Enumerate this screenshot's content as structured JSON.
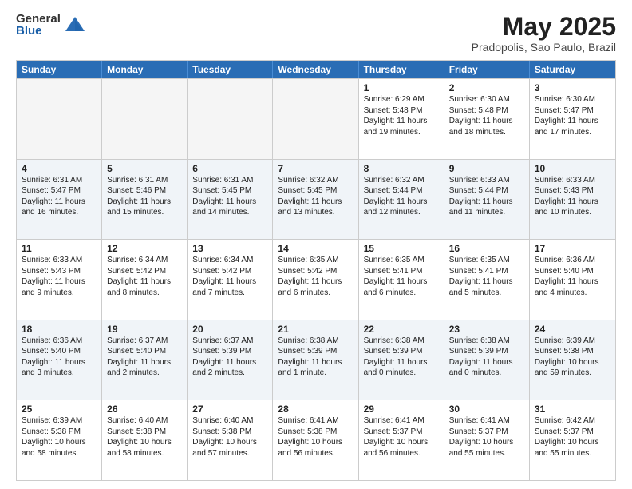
{
  "logo": {
    "general": "General",
    "blue": "Blue"
  },
  "title": "May 2025",
  "subtitle": "Pradopolis, Sao Paulo, Brazil",
  "header_days": [
    "Sunday",
    "Monday",
    "Tuesday",
    "Wednesday",
    "Thursday",
    "Friday",
    "Saturday"
  ],
  "rows": [
    [
      {
        "day": "",
        "text": "",
        "empty": true
      },
      {
        "day": "",
        "text": "",
        "empty": true
      },
      {
        "day": "",
        "text": "",
        "empty": true
      },
      {
        "day": "",
        "text": "",
        "empty": true
      },
      {
        "day": "1",
        "text": "Sunrise: 6:29 AM\nSunset: 5:48 PM\nDaylight: 11 hours\nand 19 minutes."
      },
      {
        "day": "2",
        "text": "Sunrise: 6:30 AM\nSunset: 5:48 PM\nDaylight: 11 hours\nand 18 minutes."
      },
      {
        "day": "3",
        "text": "Sunrise: 6:30 AM\nSunset: 5:47 PM\nDaylight: 11 hours\nand 17 minutes."
      }
    ],
    [
      {
        "day": "4",
        "text": "Sunrise: 6:31 AM\nSunset: 5:47 PM\nDaylight: 11 hours\nand 16 minutes."
      },
      {
        "day": "5",
        "text": "Sunrise: 6:31 AM\nSunset: 5:46 PM\nDaylight: 11 hours\nand 15 minutes."
      },
      {
        "day": "6",
        "text": "Sunrise: 6:31 AM\nSunset: 5:45 PM\nDaylight: 11 hours\nand 14 minutes."
      },
      {
        "day": "7",
        "text": "Sunrise: 6:32 AM\nSunset: 5:45 PM\nDaylight: 11 hours\nand 13 minutes."
      },
      {
        "day": "8",
        "text": "Sunrise: 6:32 AM\nSunset: 5:44 PM\nDaylight: 11 hours\nand 12 minutes."
      },
      {
        "day": "9",
        "text": "Sunrise: 6:33 AM\nSunset: 5:44 PM\nDaylight: 11 hours\nand 11 minutes."
      },
      {
        "day": "10",
        "text": "Sunrise: 6:33 AM\nSunset: 5:43 PM\nDaylight: 11 hours\nand 10 minutes."
      }
    ],
    [
      {
        "day": "11",
        "text": "Sunrise: 6:33 AM\nSunset: 5:43 PM\nDaylight: 11 hours\nand 9 minutes."
      },
      {
        "day": "12",
        "text": "Sunrise: 6:34 AM\nSunset: 5:42 PM\nDaylight: 11 hours\nand 8 minutes."
      },
      {
        "day": "13",
        "text": "Sunrise: 6:34 AM\nSunset: 5:42 PM\nDaylight: 11 hours\nand 7 minutes."
      },
      {
        "day": "14",
        "text": "Sunrise: 6:35 AM\nSunset: 5:42 PM\nDaylight: 11 hours\nand 6 minutes."
      },
      {
        "day": "15",
        "text": "Sunrise: 6:35 AM\nSunset: 5:41 PM\nDaylight: 11 hours\nand 6 minutes."
      },
      {
        "day": "16",
        "text": "Sunrise: 6:35 AM\nSunset: 5:41 PM\nDaylight: 11 hours\nand 5 minutes."
      },
      {
        "day": "17",
        "text": "Sunrise: 6:36 AM\nSunset: 5:40 PM\nDaylight: 11 hours\nand 4 minutes."
      }
    ],
    [
      {
        "day": "18",
        "text": "Sunrise: 6:36 AM\nSunset: 5:40 PM\nDaylight: 11 hours\nand 3 minutes."
      },
      {
        "day": "19",
        "text": "Sunrise: 6:37 AM\nSunset: 5:40 PM\nDaylight: 11 hours\nand 2 minutes."
      },
      {
        "day": "20",
        "text": "Sunrise: 6:37 AM\nSunset: 5:39 PM\nDaylight: 11 hours\nand 2 minutes."
      },
      {
        "day": "21",
        "text": "Sunrise: 6:38 AM\nSunset: 5:39 PM\nDaylight: 11 hours\nand 1 minute."
      },
      {
        "day": "22",
        "text": "Sunrise: 6:38 AM\nSunset: 5:39 PM\nDaylight: 11 hours\nand 0 minutes."
      },
      {
        "day": "23",
        "text": "Sunrise: 6:38 AM\nSunset: 5:39 PM\nDaylight: 11 hours\nand 0 minutes."
      },
      {
        "day": "24",
        "text": "Sunrise: 6:39 AM\nSunset: 5:38 PM\nDaylight: 10 hours\nand 59 minutes."
      }
    ],
    [
      {
        "day": "25",
        "text": "Sunrise: 6:39 AM\nSunset: 5:38 PM\nDaylight: 10 hours\nand 58 minutes."
      },
      {
        "day": "26",
        "text": "Sunrise: 6:40 AM\nSunset: 5:38 PM\nDaylight: 10 hours\nand 58 minutes."
      },
      {
        "day": "27",
        "text": "Sunrise: 6:40 AM\nSunset: 5:38 PM\nDaylight: 10 hours\nand 57 minutes."
      },
      {
        "day": "28",
        "text": "Sunrise: 6:41 AM\nSunset: 5:38 PM\nDaylight: 10 hours\nand 56 minutes."
      },
      {
        "day": "29",
        "text": "Sunrise: 6:41 AM\nSunset: 5:37 PM\nDaylight: 10 hours\nand 56 minutes."
      },
      {
        "day": "30",
        "text": "Sunrise: 6:41 AM\nSunset: 5:37 PM\nDaylight: 10 hours\nand 55 minutes."
      },
      {
        "day": "31",
        "text": "Sunrise: 6:42 AM\nSunset: 5:37 PM\nDaylight: 10 hours\nand 55 minutes."
      }
    ]
  ]
}
